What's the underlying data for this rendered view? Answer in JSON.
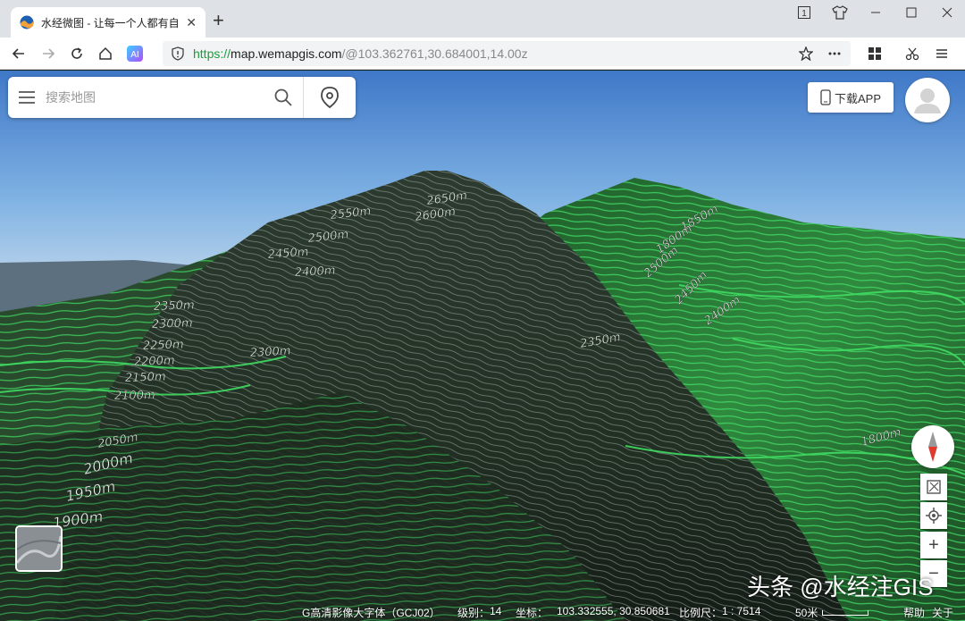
{
  "browser": {
    "tab_title": "水经微图 - 让每一个人都有自",
    "tab_close": "✕",
    "new_tab": "+",
    "url_scheme": "https://",
    "url_host": "map.wemapgis.com",
    "url_path": "/@103.362761,30.684001,14.00z",
    "window_badge": "1"
  },
  "search": {
    "placeholder": "搜索地图"
  },
  "header": {
    "download_label": "下载APP"
  },
  "contours": {
    "labels": [
      "2650m",
      "2600m",
      "2550m",
      "2500m",
      "2450m",
      "2400m",
      "2350m",
      "2300m",
      "2250m",
      "2200m",
      "2150m",
      "2100m",
      "2050m",
      "2000m",
      "1950m",
      "1900m",
      "1850m",
      "1800m",
      "2500m",
      "2450m",
      "2400m",
      "2350m",
      "2300m",
      "1800m"
    ]
  },
  "controls": {
    "zoom_in": "+",
    "zoom_out": "−"
  },
  "status": {
    "layer": "G高清影像大字体（GCJ02）",
    "level_label": "级别：",
    "level_value": "14",
    "coord_label": "坐标：",
    "coord_value": "103.332555, 30.850681",
    "scale_label": "比例尺：",
    "scale_value": "1 : 7514",
    "scale_bar_label": "50米",
    "help": "帮助",
    "about": "关于"
  },
  "watermark": "头条 @水经注GIS",
  "colors": {
    "accent_green": "#39d45a",
    "sky_top": "#3f78c8",
    "url_green": "#1a9c3c"
  }
}
